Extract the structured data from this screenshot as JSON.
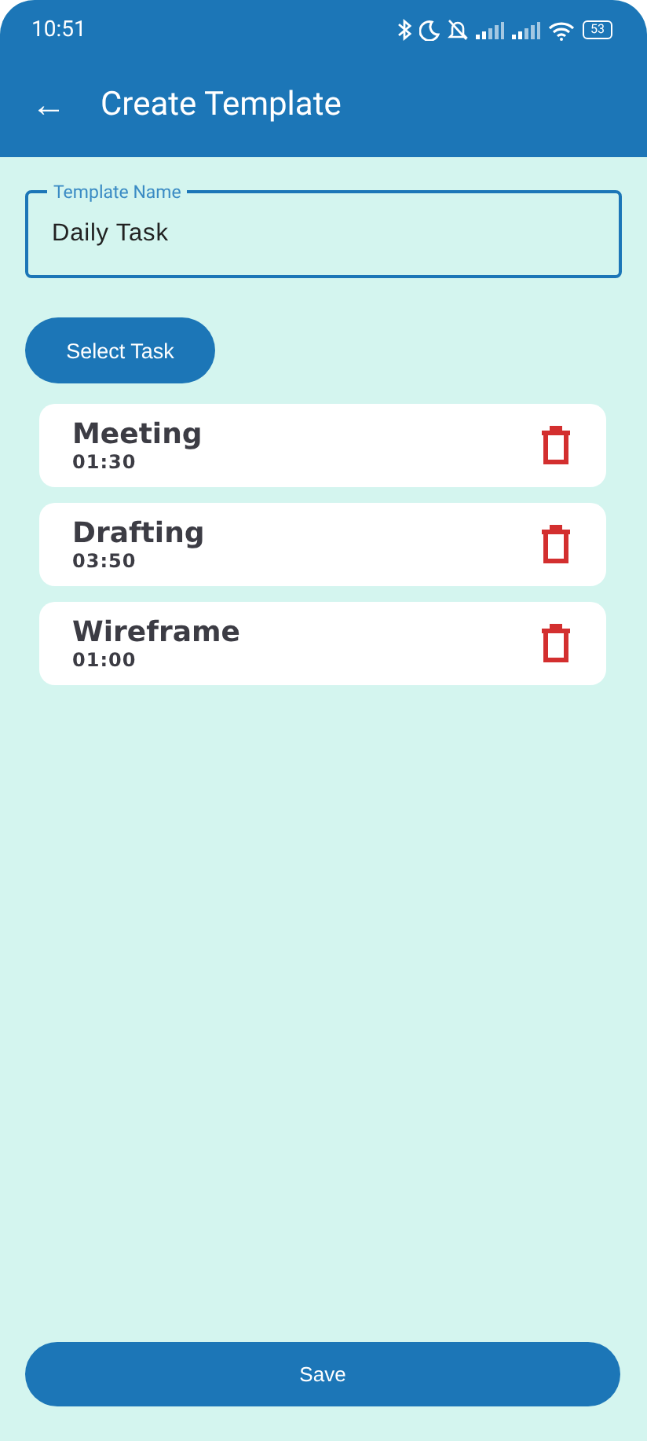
{
  "status_bar": {
    "time": "10:51",
    "battery": "53"
  },
  "app_bar": {
    "back": "←",
    "title": "Create Template"
  },
  "template_name": {
    "label": "Template Name",
    "value": "Daily Task"
  },
  "select_button": "Select Task",
  "tasks": [
    {
      "name": "Meeting",
      "duration": "01:30"
    },
    {
      "name": "Drafting",
      "duration": "03:50"
    },
    {
      "name": "Wireframe",
      "duration": "01:00"
    }
  ],
  "save_button": "Save"
}
